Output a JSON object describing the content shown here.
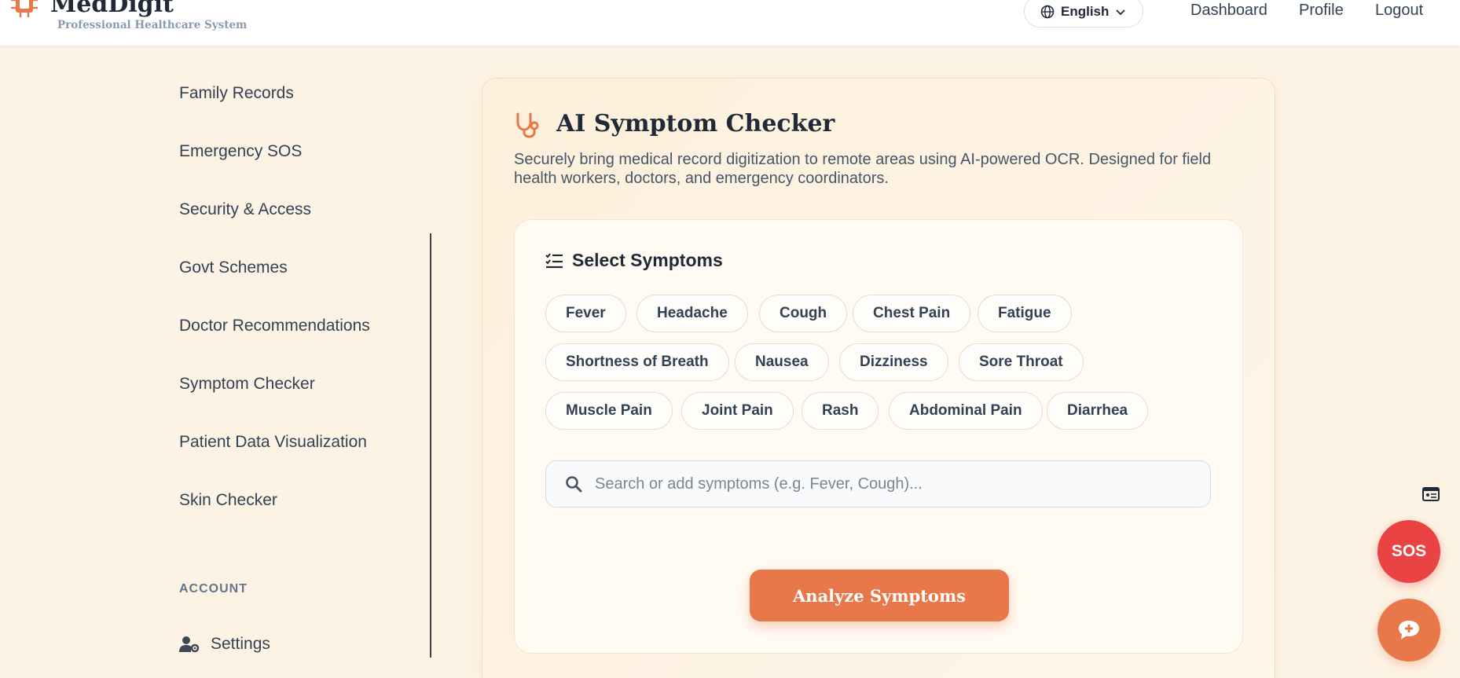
{
  "header": {
    "brand": "MedDigit",
    "tagline": "Professional Healthcare System",
    "language": "English",
    "nav": [
      "Dashboard",
      "Profile",
      "Logout"
    ]
  },
  "sidebar": {
    "items": [
      "Family Records",
      "Emergency SOS",
      "Security & Access",
      "Govt Schemes",
      "Doctor Recommendations",
      "Symptom Checker",
      "Patient Data Visualization",
      "Skin Checker"
    ],
    "section_label": "ACCOUNT",
    "settings_label": "Settings"
  },
  "main": {
    "title": "AI Symptom Checker",
    "description": "Securely bring medical record digitization to remote areas using AI-powered OCR. Designed for field health workers, doctors, and emergency coordinators.",
    "select_heading": "Select Symptoms",
    "symptoms": [
      "Fever",
      "Headache",
      "Cough",
      "Chest Pain",
      "Fatigue",
      "Shortness of Breath",
      "Nausea",
      "Dizziness",
      "Sore Throat",
      "Muscle Pain",
      "Joint Pain",
      "Rash",
      "Abdominal Pain",
      "Diarrhea"
    ],
    "search_placeholder": "Search or add symptoms (e.g. Fever, Cough)...",
    "analyze_label": "Analyze Symptoms"
  },
  "floating": {
    "sos_label": "SOS"
  },
  "colors": {
    "accent": "#e8784a",
    "sos": "#ea4343",
    "background": "#fdf3e4"
  }
}
